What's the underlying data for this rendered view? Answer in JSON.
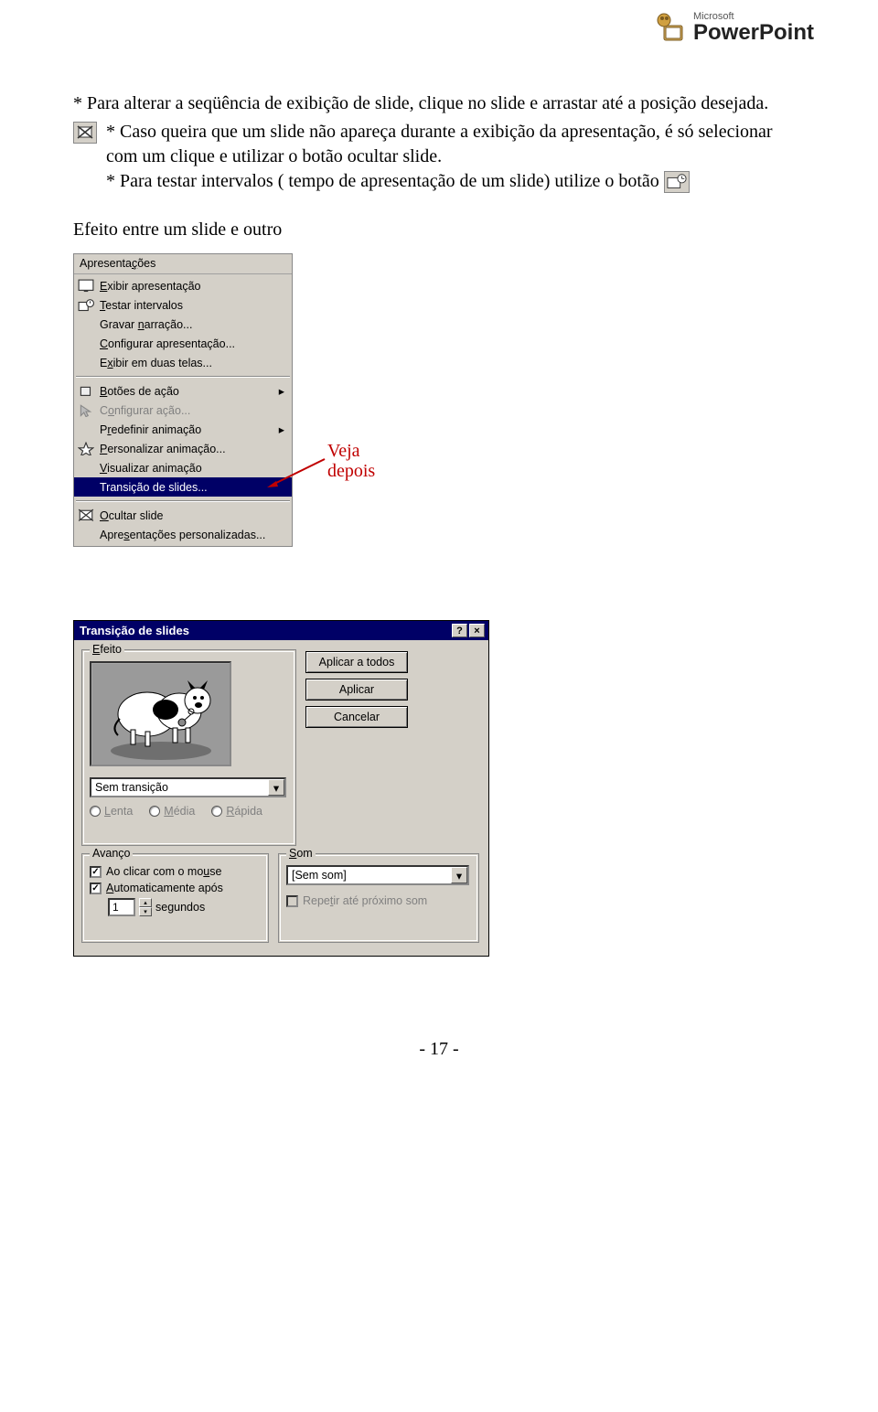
{
  "logo": {
    "ms": "Microsoft",
    "product": "PowerPoint"
  },
  "para1": "* Para alterar a seqüência de exibição de slide, clique no slide e arrastar até a posição desejada.",
  "para2": "* Caso queira que um slide não apareça durante a exibição da apresentação, é só selecionar com um clique e utilizar o botão ocultar slide.",
  "para3": "* Para testar intervalos ( tempo de apresentação de um slide) utilize o botão",
  "subtitle": "Efeito entre um slide e outro",
  "annotation": "Veja\ndepois",
  "menu": {
    "title": "Apresentações",
    "items": [
      {
        "label": "Exibir apresentação",
        "underline": "E",
        "icon": "screen"
      },
      {
        "label": "Testar intervalos",
        "underline": "T",
        "icon": "clock"
      },
      {
        "label": "Gravar narração...",
        "underline": "n"
      },
      {
        "label": "Configurar apresentação...",
        "underline": "C"
      },
      {
        "label": "Exibir em duas telas...",
        "underline": "x"
      }
    ],
    "items2": [
      {
        "label": "Botões de ação",
        "underline": "B",
        "icon": "square",
        "arrow": true
      },
      {
        "label": "Configurar ação...",
        "underline": "o",
        "icon": "pointer",
        "disabled": true
      },
      {
        "label": "Predefinir animação",
        "underline": "r",
        "arrow": true
      },
      {
        "label": "Personalizar animação...",
        "underline": "P",
        "icon": "star"
      },
      {
        "label": "Visualizar animação",
        "underline": "V"
      },
      {
        "label": "Transição de slides...",
        "selected": true
      }
    ],
    "items3": [
      {
        "label": "Ocultar slide",
        "underline": "O",
        "icon": "hide"
      },
      {
        "label": "Apresentações personalizadas...",
        "underline": "s"
      }
    ]
  },
  "dialog": {
    "title": "Transição de slides",
    "buttons": {
      "applyAll": "Aplicar a todos",
      "apply": "Aplicar",
      "cancel": "Cancelar"
    },
    "effect": {
      "legend": "Efeito",
      "transition": "Sem transição",
      "speed": {
        "slow": "Lenta",
        "med": "Média",
        "fast": "Rápida"
      }
    },
    "advance": {
      "legend": "Avanço",
      "onClick": "Ao clicar com o mouse",
      "auto": "Automaticamente após",
      "seconds": "segundos",
      "secValue": "1"
    },
    "sound": {
      "legend": "Som",
      "value": "[Sem som]",
      "loop": "Repetir até próximo som"
    }
  },
  "pagenum": "- 17 -"
}
